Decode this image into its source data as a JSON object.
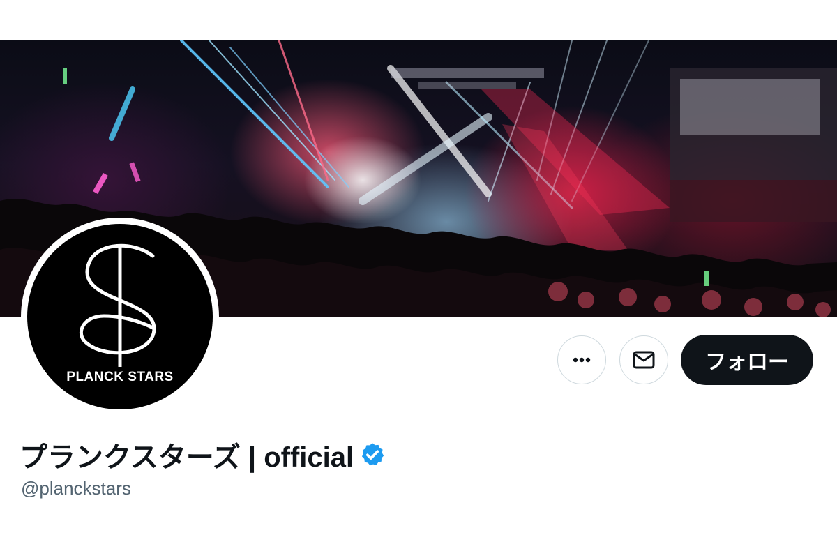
{
  "banner": {
    "description_icon": "concert-stage-banner"
  },
  "avatar": {
    "logo_text": "PLANCK STARS"
  },
  "actions": {
    "more_icon": "ellipsis-icon",
    "dm_icon": "mail-icon",
    "follow_label": "フォロー"
  },
  "profile": {
    "display_name": "プランクスターズ | official",
    "handle": "@planckstars",
    "verified": true
  },
  "colors": {
    "follow_bg": "#0f1419",
    "verified_badge": "#1d9bf0",
    "handle_text": "#536471"
  }
}
